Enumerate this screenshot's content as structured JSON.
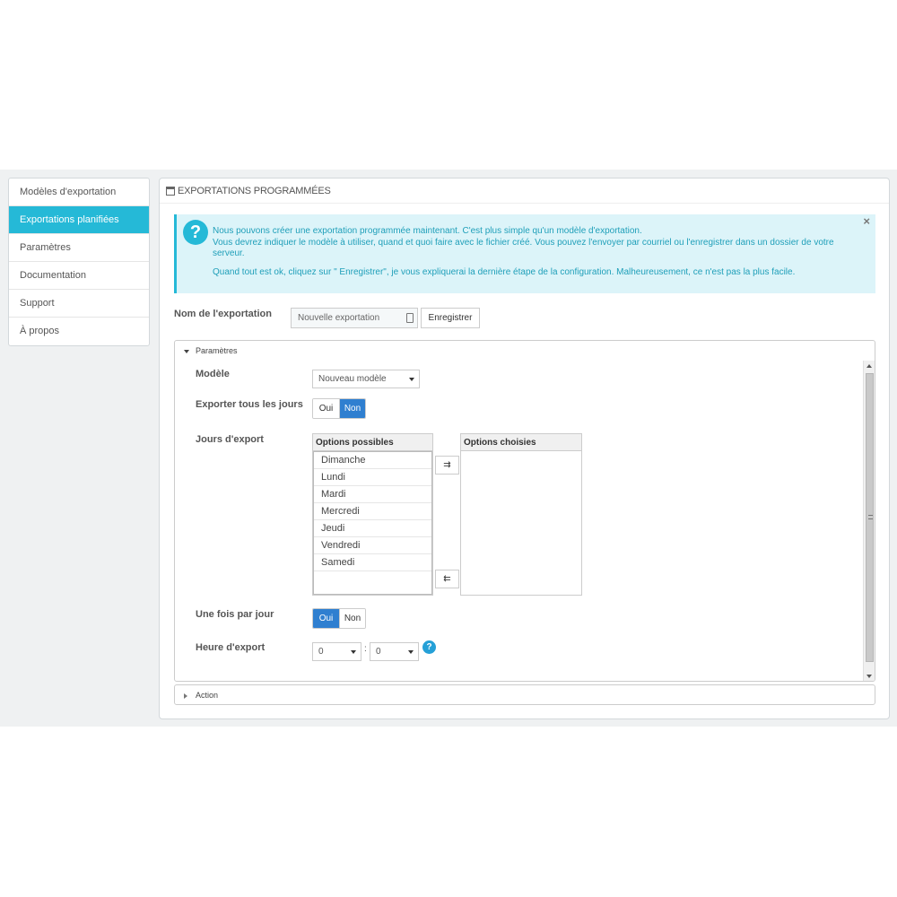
{
  "sidebar": {
    "items": [
      {
        "label": "Modèles d'exportation",
        "active": false
      },
      {
        "label": "Exportations planifiées",
        "active": true
      },
      {
        "label": "Paramètres",
        "active": false
      },
      {
        "label": "Documentation",
        "active": false
      },
      {
        "label": "Support",
        "active": false
      },
      {
        "label": "À propos",
        "active": false
      }
    ]
  },
  "panel": {
    "title": "EXPORTATIONS PROGRAMMÉES"
  },
  "alert": {
    "line1": "Nous pouvons créer une exportation programmée maintenant. C'est plus simple qu'un modèle d'exportation.",
    "line2": "Vous devrez indiquer le modèle à utiliser, quand et quoi faire avec le fichier créé. Vous pouvez l'envoyer par courriel ou l'enregistrer dans un dossier de votre serveur.",
    "line3": "Quand tout est ok, cliquez sur \" Enregistrer\", je vous expliquerai la dernière étape de la configuration. Malheureusement, ce n'est pas la plus facile.",
    "close": "×",
    "icon_glyph": "?"
  },
  "export_name": {
    "label": "Nom de l'exportation",
    "value": "Nouvelle exportation",
    "save_label": "Enregistrer"
  },
  "params": {
    "section_label": "Paramètres",
    "model": {
      "label": "Modèle",
      "selected": "Nouveau modèle"
    },
    "every_day": {
      "label": "Exporter tous les jours",
      "yes": "Oui",
      "no": "Non",
      "value": "Non"
    },
    "days": {
      "label": "Jours d'export",
      "available_header": "Options possibles",
      "chosen_header": "Options choisies",
      "available": [
        "Dimanche",
        "Lundi",
        "Mardi",
        "Mercredi",
        "Jeudi",
        "Vendredi",
        "Samedi"
      ],
      "chosen": [],
      "add_glyph": "⇉",
      "remove_glyph": "⇇"
    },
    "once_per_day": {
      "label": "Une fois par jour",
      "yes": "Oui",
      "no": "Non",
      "value": "Oui"
    },
    "export_time": {
      "label": "Heure d'export",
      "hour": "0",
      "separator": ":",
      "minute": "0",
      "help_glyph": "?"
    }
  },
  "action": {
    "section_label": "Action"
  },
  "colors": {
    "accent": "#25b9d7",
    "toggle_on": "#2f7fd0",
    "alert_bg": "#dcf4f9"
  }
}
